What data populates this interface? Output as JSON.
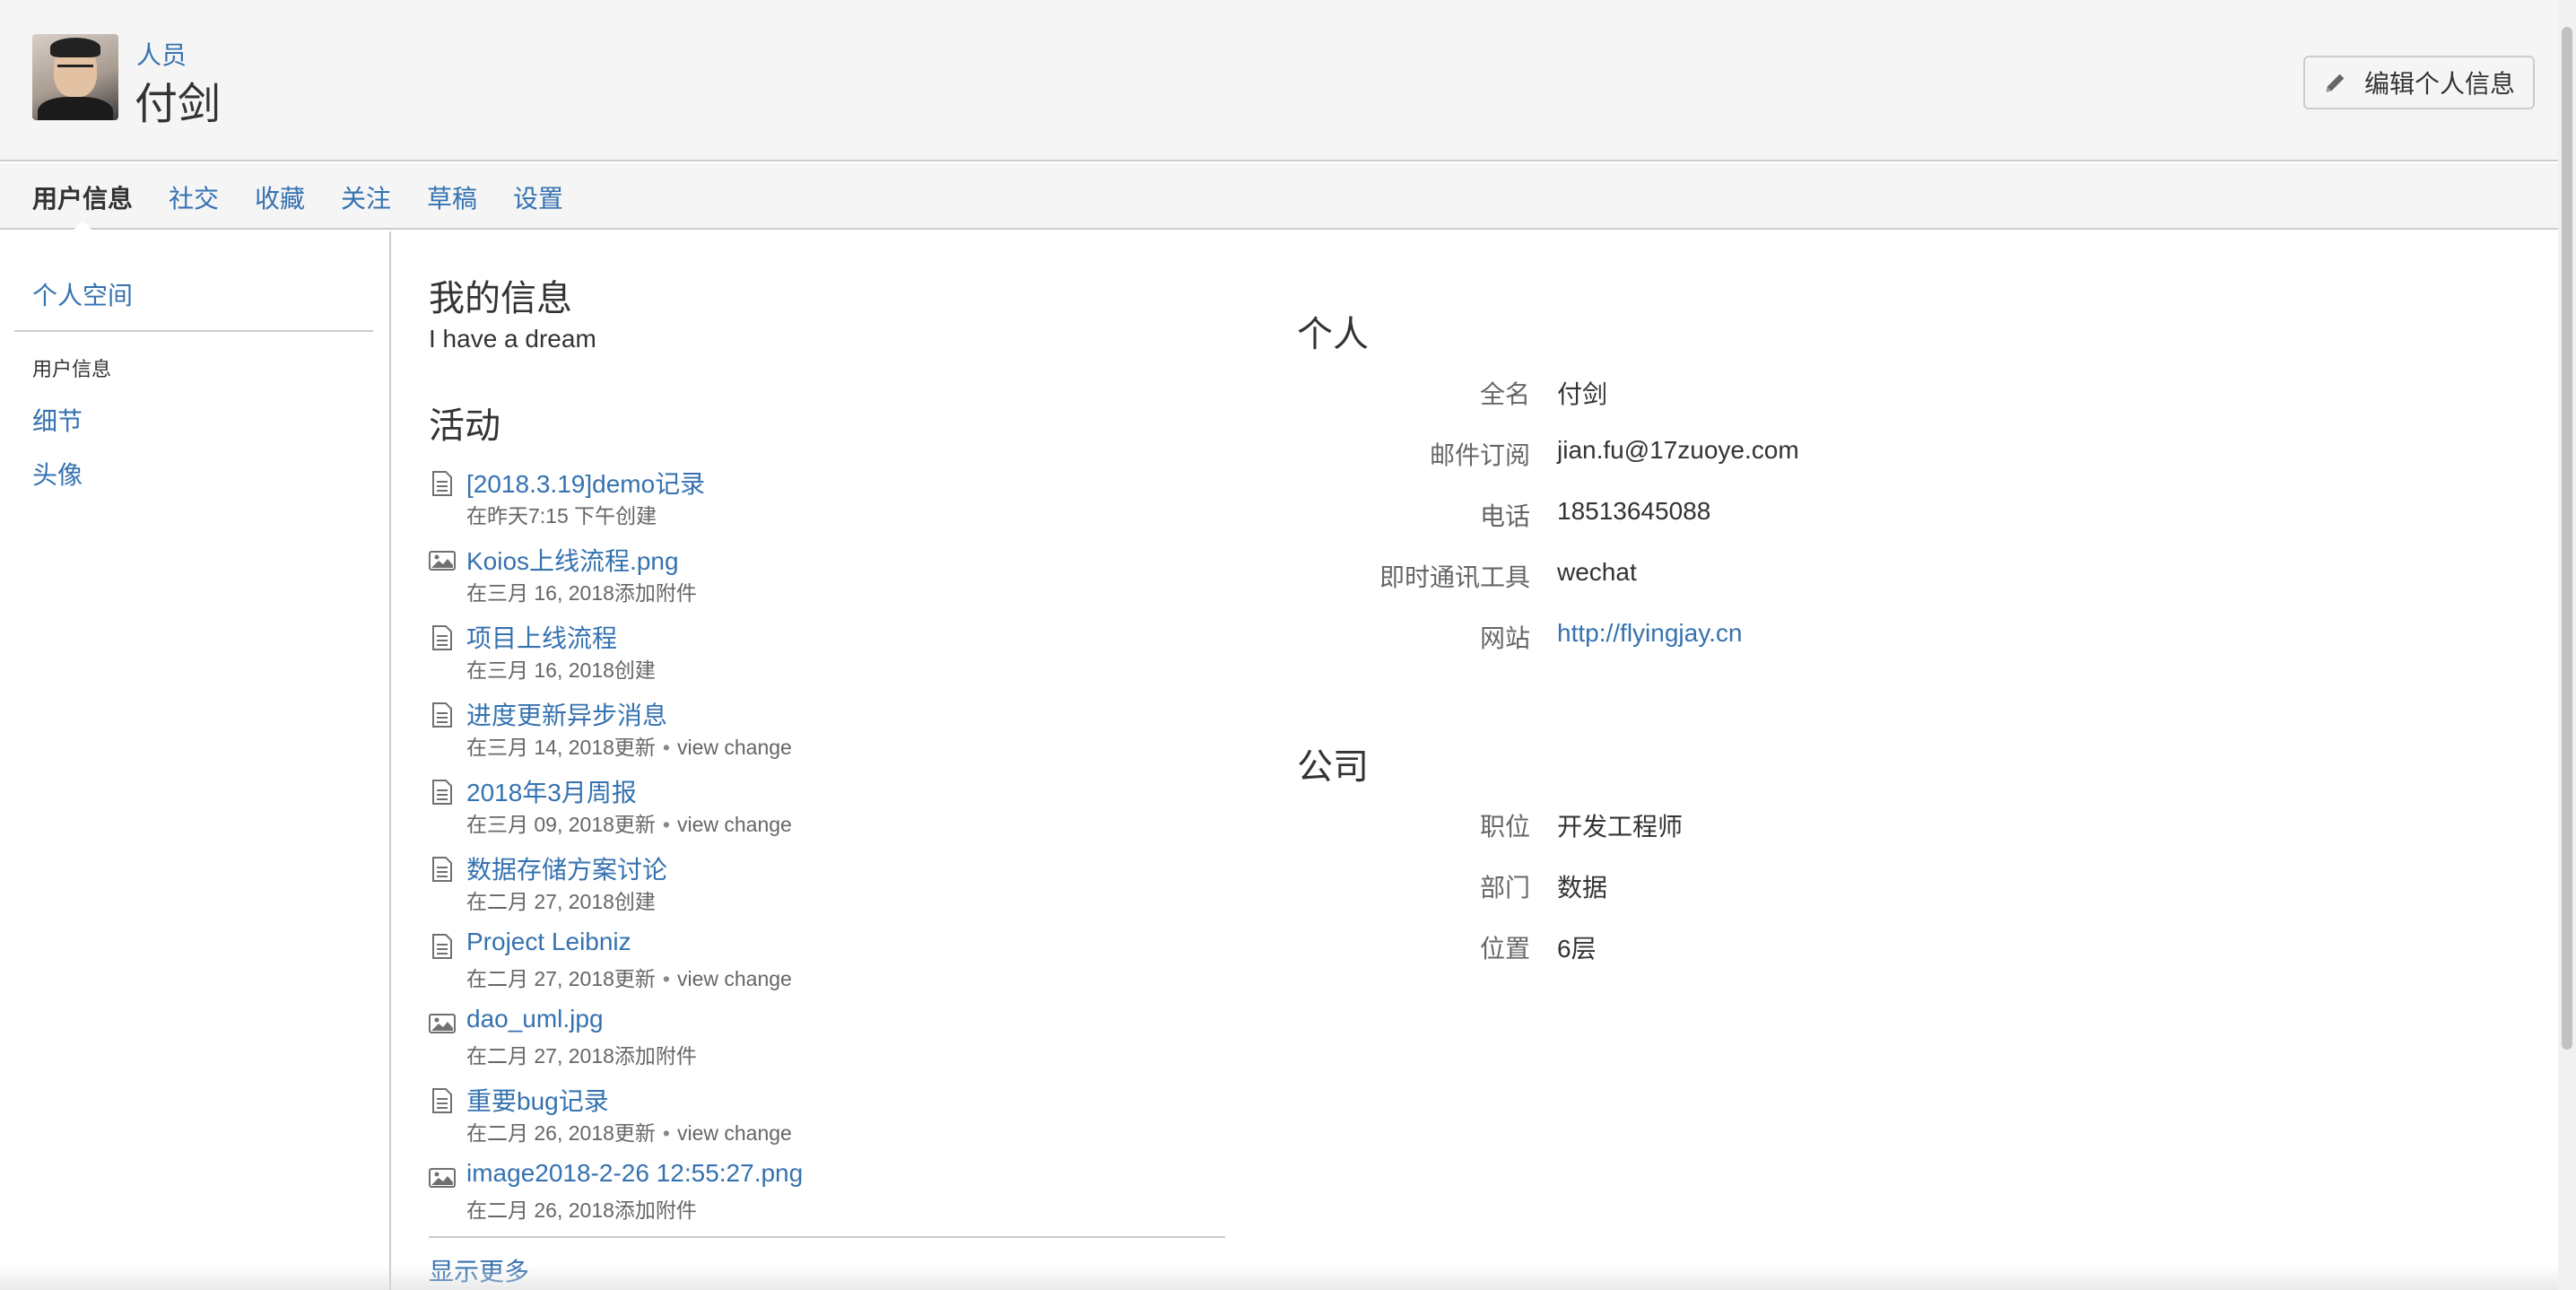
{
  "header": {
    "breadcrumb": "人员",
    "title": "付剑",
    "edit_button": "编辑个人信息"
  },
  "tabs": [
    {
      "label": "用户信息",
      "active": true
    },
    {
      "label": "社交"
    },
    {
      "label": "收藏"
    },
    {
      "label": "关注"
    },
    {
      "label": "草稿"
    },
    {
      "label": "设置"
    }
  ],
  "sidebar": {
    "space_link": "个人空间",
    "section_label": "用户信息",
    "items": [
      "细节",
      "头像"
    ]
  },
  "about": {
    "heading": "我的信息",
    "text": "I have a dream"
  },
  "activity": {
    "heading": "活动",
    "items": [
      {
        "icon": "document-icon",
        "title": "[2018.3.19]demo记录",
        "meta": "在昨天7:15 下午创建"
      },
      {
        "icon": "image-icon",
        "title": "Koios上线流程.png",
        "meta": "在三月 16, 2018添加附件"
      },
      {
        "icon": "document-icon",
        "title": "项目上线流程",
        "meta": "在三月 16, 2018创建"
      },
      {
        "icon": "document-icon",
        "title": "进度更新异步消息",
        "meta": "在三月 14, 2018更新",
        "view_change": "view change"
      },
      {
        "icon": "document-icon",
        "title": "2018年3月周报",
        "meta": "在三月 09, 2018更新",
        "view_change": "view change"
      },
      {
        "icon": "document-icon",
        "title": "数据存储方案讨论",
        "meta": "在二月 27, 2018创建"
      },
      {
        "icon": "document-icon",
        "title": "Project Leibniz",
        "meta": "在二月 27, 2018更新",
        "view_change": "view change"
      },
      {
        "icon": "image-icon",
        "title": "dao_uml.jpg",
        "meta": "在二月 27, 2018添加附件"
      },
      {
        "icon": "document-icon",
        "title": "重要bug记录",
        "meta": "在二月 26, 2018更新",
        "view_change": "view change"
      },
      {
        "icon": "image-icon",
        "title": "image2018-2-26 12:55:27.png",
        "meta": "在二月 26, 2018添加附件"
      }
    ],
    "show_more": "显示更多"
  },
  "personal": {
    "heading": "个人",
    "fields": [
      {
        "label": "全名",
        "value": "付剑"
      },
      {
        "label": "邮件订阅",
        "value": "jian.fu@17zuoye.com"
      },
      {
        "label": "电话",
        "value": "18513645088"
      },
      {
        "label": "即时通讯工具",
        "value": "wechat"
      },
      {
        "label": "网站",
        "value": "http://flyingjay.cn",
        "is_link": true
      }
    ]
  },
  "company": {
    "heading": "公司",
    "fields": [
      {
        "label": "职位",
        "value": "开发工程师"
      },
      {
        "label": "部门",
        "value": "数据"
      },
      {
        "label": "位置",
        "value": "6层"
      }
    ]
  },
  "colors": {
    "link": "#3572b0",
    "header_bg": "#f5f5f5",
    "border": "#cccccc"
  }
}
